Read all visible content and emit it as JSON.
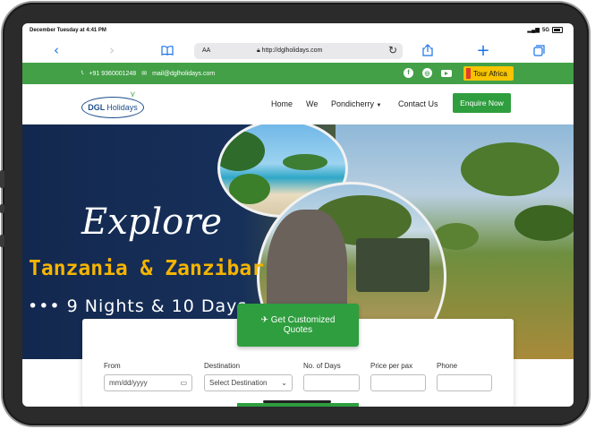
{
  "status_bar": {
    "time": "December Tuesday at 4:41 PM",
    "network": "5G"
  },
  "browser": {
    "text_size": "AA",
    "url": "http://dglholidays.com"
  },
  "topbar": {
    "phone": "+91 9360001248",
    "email": "mail@dglholidays.com",
    "tour_button": "Tour Africa"
  },
  "navbar": {
    "logo": {
      "bold": "DGL",
      "text": "Holidays"
    },
    "items": [
      "Home",
      "We",
      "Pondicherry",
      "Contact Us"
    ],
    "enquire": "Enquire Now"
  },
  "hero": {
    "headline": "Explore",
    "destination": "Tanzania & Zanzibar",
    "duration": "••• 9 Nights & 10 Days"
  },
  "quote_button": {
    "line1": "Get Customized",
    "line2": "Quotes"
  },
  "form": {
    "fields": [
      {
        "label": "From",
        "value": "mm/dd/yyyy"
      },
      {
        "label": "Destination",
        "value": "Select Destination"
      },
      {
        "label": "No. of Days",
        "value": ""
      },
      {
        "label": "Price per pax",
        "value": ""
      },
      {
        "label": "Phone",
        "value": ""
      }
    ]
  },
  "colors": {
    "brand_green": "#43a047",
    "button_green": "#2e9e3e",
    "accent_yellow": "#f5b400",
    "navy": "#13284f"
  }
}
